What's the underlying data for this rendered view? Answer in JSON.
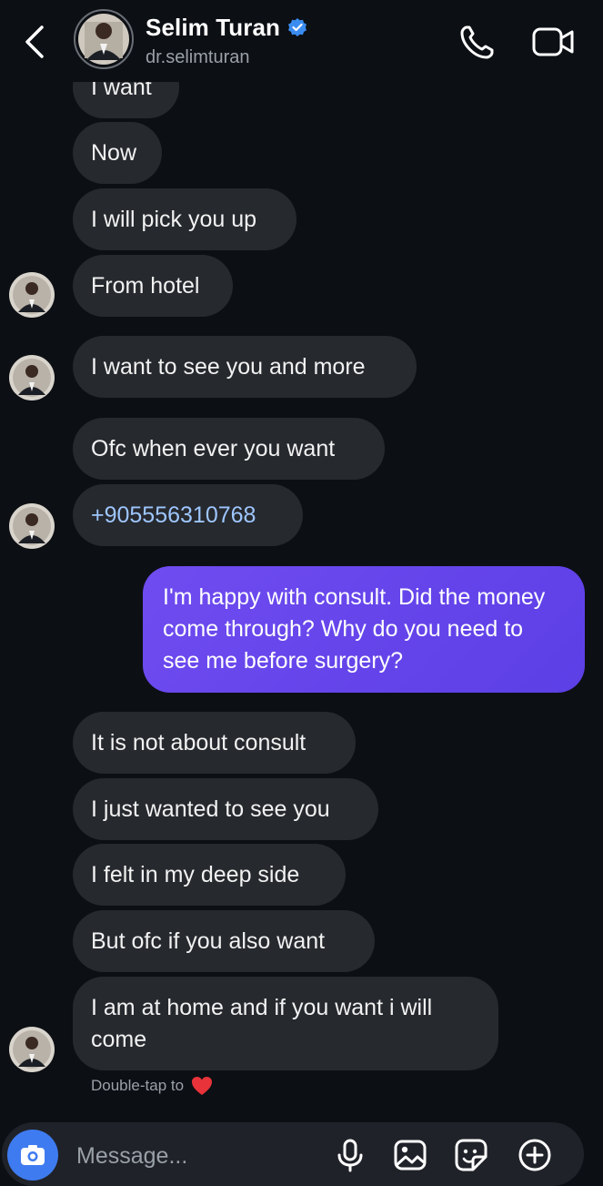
{
  "header": {
    "name": "Selim Turan",
    "username": "dr.selimturan",
    "verified": true
  },
  "messages": [
    {
      "dir": "in",
      "text": "I want",
      "partial": true
    },
    {
      "dir": "in",
      "text": "Now"
    },
    {
      "dir": "in",
      "text": "I will pick you up"
    },
    {
      "dir": "in",
      "text": "From hotel",
      "avatar": true
    },
    {
      "dir": "in",
      "text": "I want to see you and more",
      "avatar": true
    },
    {
      "dir": "in",
      "text": "Ofc when ever you want"
    },
    {
      "dir": "in",
      "text": "+905556310768",
      "avatar": true,
      "link": true
    },
    {
      "dir": "out",
      "text": "I'm happy with consult. Did the money come through? Why do you need to see me before surgery?"
    },
    {
      "dir": "in",
      "text": "It is not about consult"
    },
    {
      "dir": "in",
      "text": "I just wanted to see you"
    },
    {
      "dir": "in",
      "text": "I felt in my deep side"
    },
    {
      "dir": "in",
      "text": "But ofc if you also want"
    },
    {
      "dir": "in",
      "text": "I am at home and if you want i will come",
      "avatar": true
    }
  ],
  "reaction_hint": "Double-tap to",
  "composer": {
    "placeholder": "Message..."
  },
  "colors": {
    "background": "#0c0f14",
    "incoming_bubble": "#26292e",
    "outgoing_bubble": "#6448ec",
    "link": "#9ec6ff",
    "verified": "#3b8cf0",
    "camera_button": "#3f7bf0",
    "heart": "#e8333a"
  },
  "icons": [
    "back-chevron-icon",
    "verified-badge-icon",
    "phone-icon",
    "video-camera-icon",
    "heart-icon",
    "camera-icon",
    "microphone-icon",
    "image-icon",
    "sticker-icon",
    "plus-icon"
  ]
}
